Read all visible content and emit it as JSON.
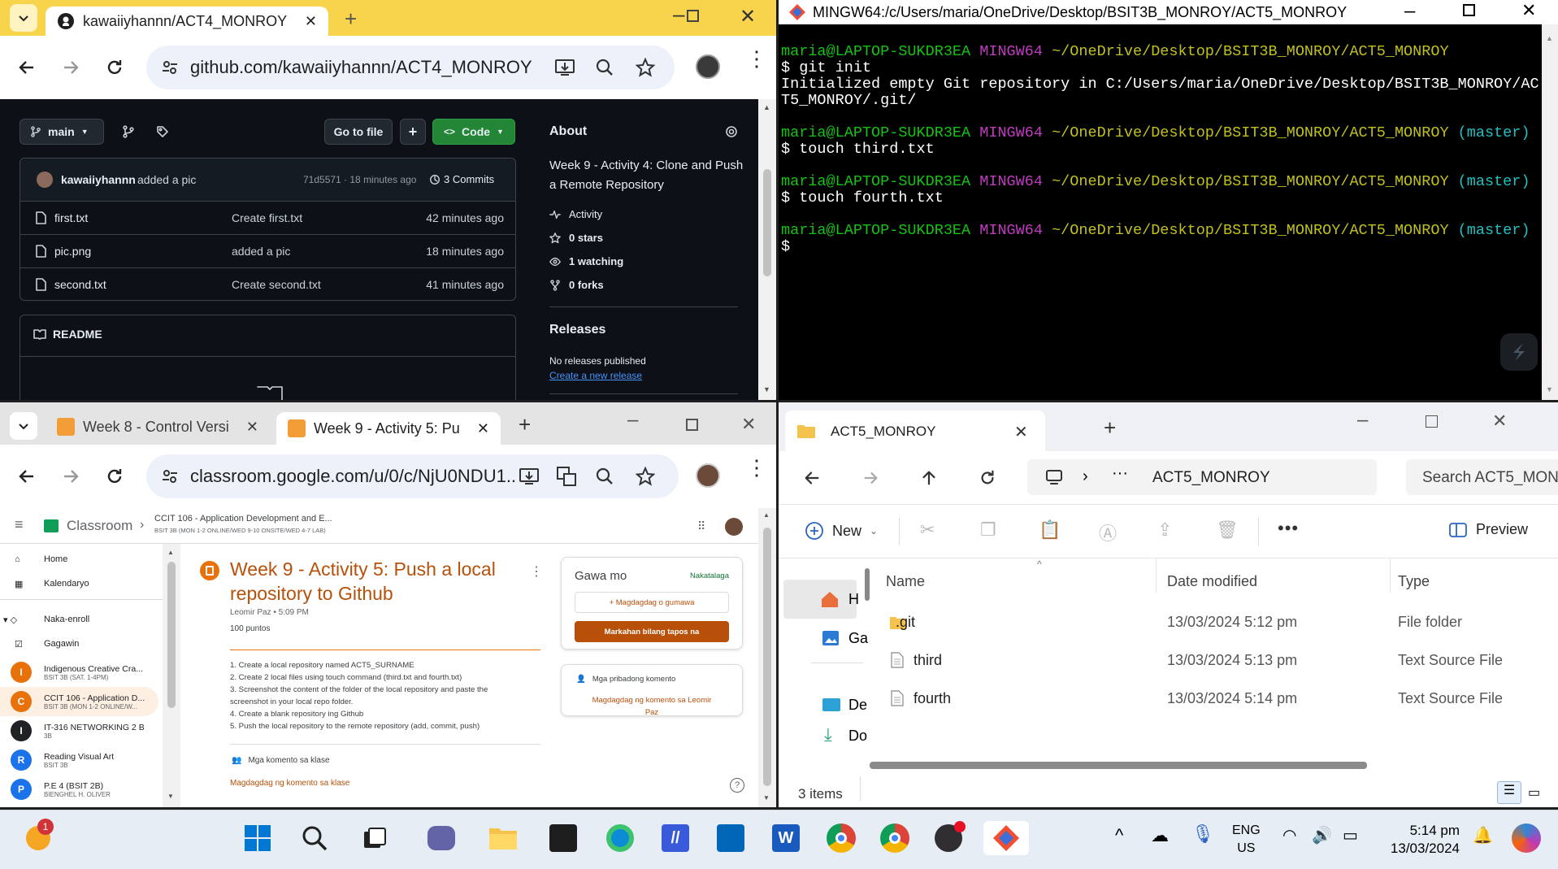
{
  "chrome_top": {
    "tab_title": "kawaiiyhannn/ACT4_MONROY",
    "url": "github.com/kawaiiyhannn/ACT4_MONROY"
  },
  "github": {
    "branch": "main",
    "go_to_file": "Go to file",
    "add": "+",
    "code": "Code",
    "commit": {
      "author": "kawaiiyhannn",
      "message": "added a pic",
      "hash_time": "71d5571 · 18 minutes ago",
      "commits": "3 Commits"
    },
    "files": [
      {
        "name": "first.txt",
        "message": "Create first.txt",
        "time": "42 minutes ago"
      },
      {
        "name": "pic.png",
        "message": "added a pic",
        "time": "18 minutes ago"
      },
      {
        "name": "second.txt",
        "message": "Create second.txt",
        "time": "41 minutes ago"
      }
    ],
    "readme": "README",
    "about": {
      "title": "About",
      "description": "Week 9 - Activity 4: Clone and Push a Remote Repository",
      "activity": "Activity",
      "stars": "0 stars",
      "watching": "1 watching",
      "forks": "0 forks"
    },
    "releases": {
      "title": "Releases",
      "none": "No releases published",
      "create": "Create a new release"
    }
  },
  "terminal": {
    "title": "MINGW64:/c/Users/maria/OneDrive/Desktop/BSIT3B_MONROY/ACT5_MONROY",
    "user_host": "maria@LAPTOP-SUKDR3EA",
    "shell": "MINGW64",
    "path": "~/OneDrive/Desktop/BSIT3B_MONROY/ACT5_MONROY",
    "branch": "(master)",
    "cmd1": "$ git init",
    "out1a": "Initialized empty Git repository in C:/Users/maria/OneDrive/Desktop/BSIT3B_MONROY/AC",
    "out1b": "T5_MONROY/.git/",
    "cmd2": "$ touch third.txt",
    "cmd3": "$ touch fourth.txt",
    "cmd4": "$"
  },
  "chrome_bottom": {
    "tab1": "Week 8 - Control Versi",
    "tab2": "Week 9 - Activity 5: Pu",
    "url": "classroom.google.com/u/0/c/NjU0NDU1..."
  },
  "classroom": {
    "app": "Classroom",
    "course_title": "CCIT 106 - Application Development and E...",
    "course_sub": "BSIT 3B (MON 1-2 ONLINE/WED 9-10 ONSITE/WED 4-7 LAB)",
    "nav": {
      "home": "Home",
      "calendar": "Kalendaryo",
      "enrolled": "Naka-enroll",
      "todo": "Gagawin"
    },
    "classes": [
      {
        "initial": "I",
        "name": "Indigenous Creative Cra...",
        "sub": "BSIT 3B (SAT. 1-4PM)",
        "color": "#e8710a"
      },
      {
        "initial": "C",
        "name": "CCIT 106 - Application D...",
        "sub": "BSIT 3B (MON 1-2 ONLINE/W...",
        "color": "#e8710a"
      },
      {
        "initial": "I",
        "name": "IT-316 NETWORKING 2 B",
        "sub": "3B",
        "color": "#202124"
      },
      {
        "initial": "R",
        "name": "Reading Visual Art",
        "sub": "BSIT 3B",
        "color": "#1a73e8"
      },
      {
        "initial": "P",
        "name": "P.E 4 (BSIT 2B)",
        "sub": "BIENGHEL H. OLIVER",
        "color": "#1a73e8"
      }
    ],
    "assignment": {
      "title": "Week 9 - Activity 5: Push a local repository to Github",
      "author": "Leomir Paz • 5:09 PM",
      "points": "100 puntos",
      "steps": [
        "1. Create a local repository named ACT5_SURNAME",
        "2. Create 2 local files using touch command (third.txt and fourth.txt)",
        "3. Screenshot the content of the folder of the local repository and paste the",
        "screenshot in your local repo folder.",
        "4. Create a blank repository ing Github",
        "5. Push the local repository to the remote repository (add, commit, push)"
      ],
      "class_comments": "Mga komento sa klase",
      "add_class_comment": "Magdagdag ng komento sa klase"
    },
    "work": {
      "title": "Gawa mo",
      "status": "Nakatalaga",
      "add": "+ Magdagdag o gumawa",
      "mark": "Markahan bilang tapos na"
    },
    "private": {
      "title": "Mga pribadong komento",
      "add": "Magdagdag ng komento sa Leomir",
      "add2": "Paz"
    }
  },
  "explorer": {
    "tab": "ACT5_MONROY",
    "folder": "ACT5_MONROY",
    "search": "Search ACT5_MON",
    "new": "New",
    "preview": "Preview",
    "columns": [
      "Name",
      "Date modified",
      "Type"
    ],
    "files": [
      {
        "name": ".git",
        "date": "13/03/2024 5:12 pm",
        "type": "File folder"
      },
      {
        "name": "third",
        "date": "13/03/2024 5:13 pm",
        "type": "Text Source File"
      },
      {
        "name": "fourth",
        "date": "13/03/2024 5:14 pm",
        "type": "Text Source File"
      }
    ],
    "nav": [
      "H",
      "Ga",
      "De",
      "Do"
    ],
    "status": "3 items"
  },
  "taskbar": {
    "badge": "1",
    "lang1": "ENG",
    "lang2": "US",
    "time": "5:14 pm",
    "date": "13/03/2024"
  }
}
